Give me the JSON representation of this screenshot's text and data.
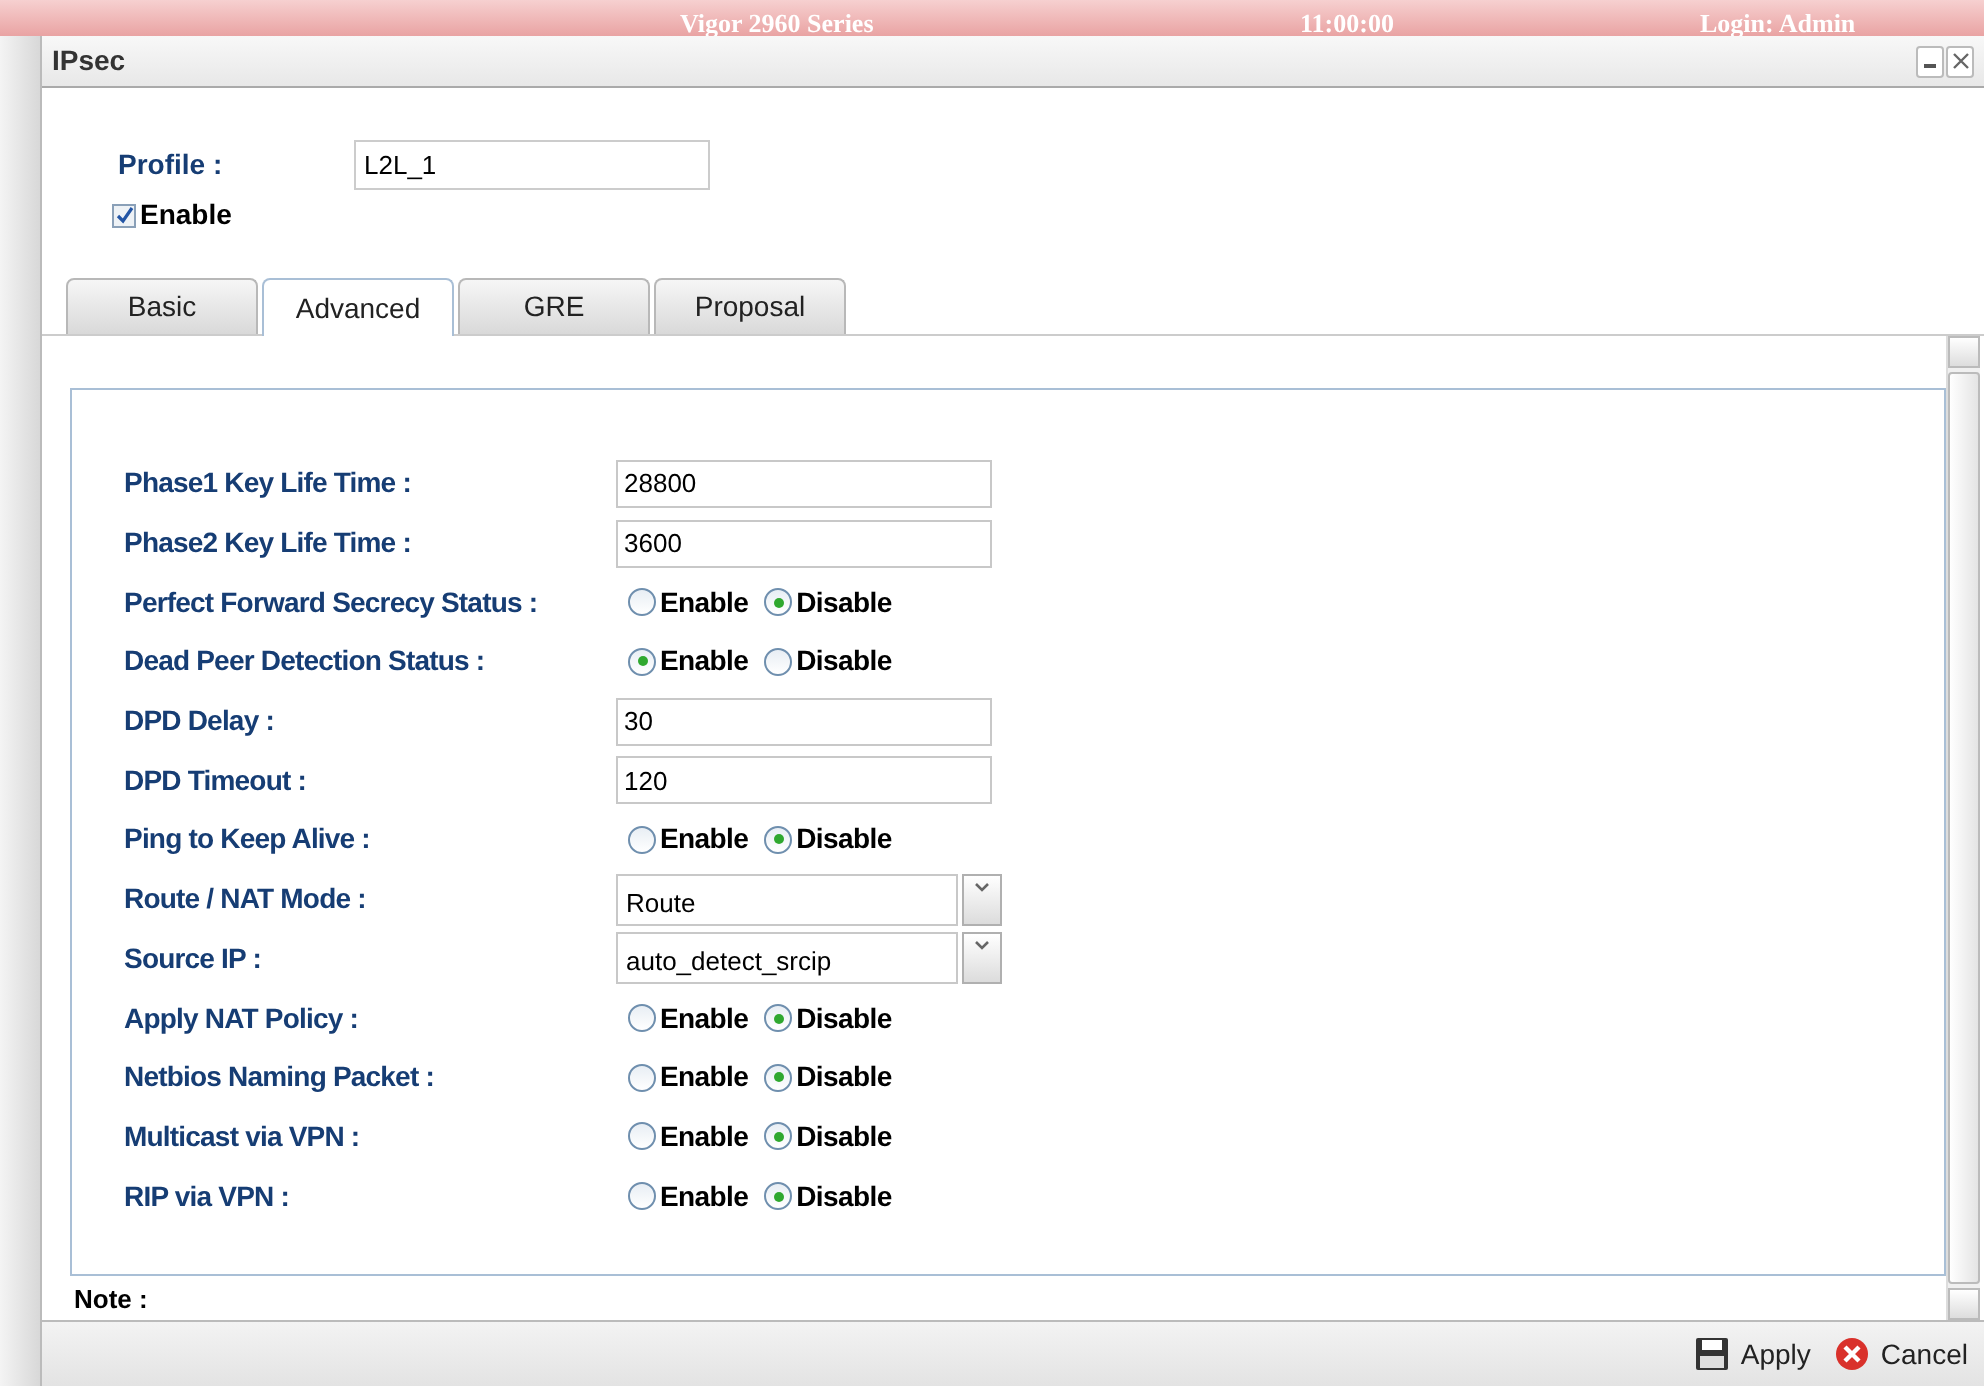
{
  "background_header": {
    "title": "Vigor 2960 Series",
    "time": "11:00:00",
    "login": "Login: Admin"
  },
  "window": {
    "title": "IPsec"
  },
  "profile": {
    "label": "Profile :",
    "value": "L2L_1"
  },
  "enable": {
    "label": "Enable",
    "checked": true
  },
  "tabs": [
    {
      "label": "Basic",
      "selected": false
    },
    {
      "label": "Advanced",
      "selected": true
    },
    {
      "label": "GRE",
      "selected": false
    },
    {
      "label": "Proposal",
      "selected": false
    }
  ],
  "rows": [
    {
      "kind": "input",
      "label": "Phase1 Key Life Time :",
      "value": "28800"
    },
    {
      "kind": "input",
      "label": "Phase2 Key Life Time :",
      "value": "3600"
    },
    {
      "kind": "radio",
      "label": "Perfect Forward Secrecy Status :",
      "options": [
        {
          "label": "Enable",
          "selected": false
        },
        {
          "label": "Disable",
          "selected": true
        }
      ]
    },
    {
      "kind": "radio",
      "label": "Dead Peer Detection Status :",
      "options": [
        {
          "label": "Enable",
          "selected": true
        },
        {
          "label": "Disable",
          "selected": false
        }
      ]
    },
    {
      "kind": "input",
      "label": "DPD Delay :",
      "value": "30"
    },
    {
      "kind": "input",
      "label": "DPD Timeout :",
      "value": "120"
    },
    {
      "kind": "radio",
      "label": "Ping to Keep Alive :",
      "options": [
        {
          "label": "Enable",
          "selected": false
        },
        {
          "label": "Disable",
          "selected": true
        }
      ]
    },
    {
      "kind": "select",
      "label": "Route / NAT Mode :",
      "value": "Route"
    },
    {
      "kind": "select",
      "label": "Source IP :",
      "value": "auto_detect_srcip"
    },
    {
      "kind": "radio",
      "label": "Apply NAT Policy :",
      "options": [
        {
          "label": "Enable",
          "selected": false
        },
        {
          "label": "Disable",
          "selected": true
        }
      ]
    },
    {
      "kind": "radio",
      "label": "Netbios Naming Packet :",
      "options": [
        {
          "label": "Enable",
          "selected": false
        },
        {
          "label": "Disable",
          "selected": true
        }
      ]
    },
    {
      "kind": "radio",
      "label": "Multicast via VPN :",
      "options": [
        {
          "label": "Enable",
          "selected": false
        },
        {
          "label": "Disable",
          "selected": true
        }
      ]
    },
    {
      "kind": "radio",
      "label": "RIP via VPN :",
      "options": [
        {
          "label": "Enable",
          "selected": false
        },
        {
          "label": "Disable",
          "selected": true
        }
      ]
    }
  ],
  "note": "Note :",
  "footer_buttons": [
    {
      "kind": "apply",
      "label": "Apply"
    },
    {
      "kind": "cancel",
      "label": "Cancel"
    }
  ]
}
